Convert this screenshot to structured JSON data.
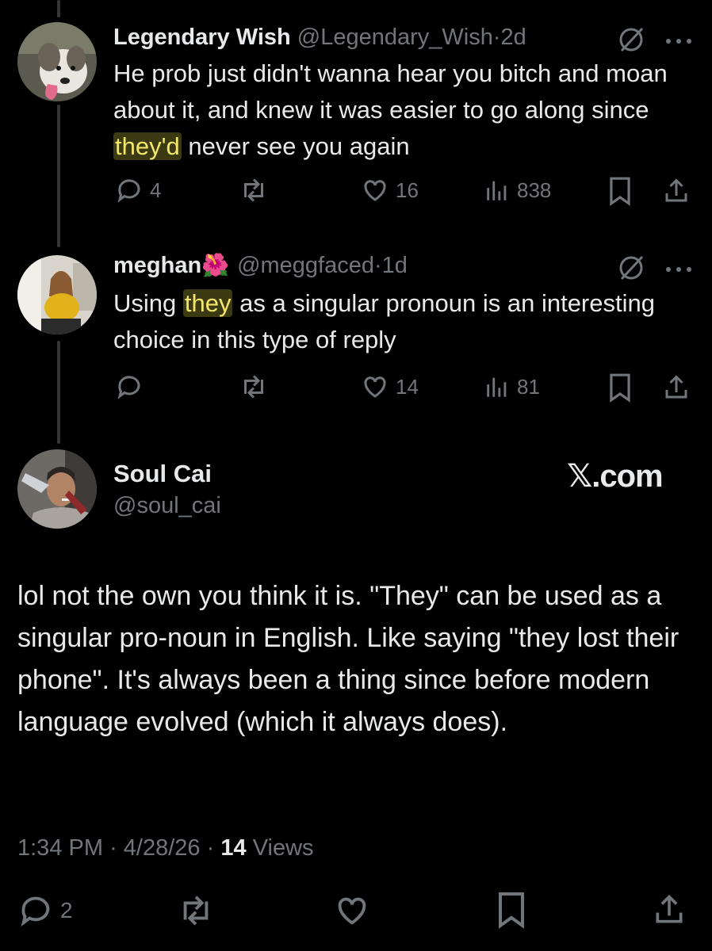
{
  "tweets": [
    {
      "name": "Legendary Wish",
      "handle": "@Legendary_Wish",
      "sep": "·",
      "age": "2d",
      "text_before": "He prob just didn't wanna hear you bitch and moan about it, and knew it was easier to go along since ",
      "highlight": "they'd",
      "text_after": " never see you again",
      "replies": "4",
      "reposts": "",
      "likes": "16",
      "views": "838",
      "avatar_icon": "dog-avatar"
    },
    {
      "name": "meghan",
      "emoji": "🌺",
      "handle": "@meggfaced",
      "sep": "·",
      "age": "1d",
      "text_before": "Using ",
      "highlight": "they",
      "text_after": " as a singular pronoun is an interesting choice in this type of reply",
      "replies": "",
      "reposts": "",
      "likes": "14",
      "views": "81",
      "avatar_icon": "woman-avatar"
    }
  ],
  "main": {
    "name": "Soul Cai",
    "handle": "@soul_cai",
    "brand": "𝕏.com",
    "text": "lol not the own you think it is. \"They\" can be used as a singular pro-noun in English. Like saying \"they lost their phone\". It's always been a thing since before modern language evolved (which it always does).",
    "time": "1:34 PM",
    "date": "4/28/26",
    "sep": "·",
    "views_count": "14",
    "views_label": "Views",
    "replies": "2"
  },
  "colors": {
    "background": "#000000",
    "text": "#e7e9ea",
    "muted": "#71767b",
    "highlight_bg": "#3c3a12",
    "highlight_fg": "#f2e66b"
  }
}
